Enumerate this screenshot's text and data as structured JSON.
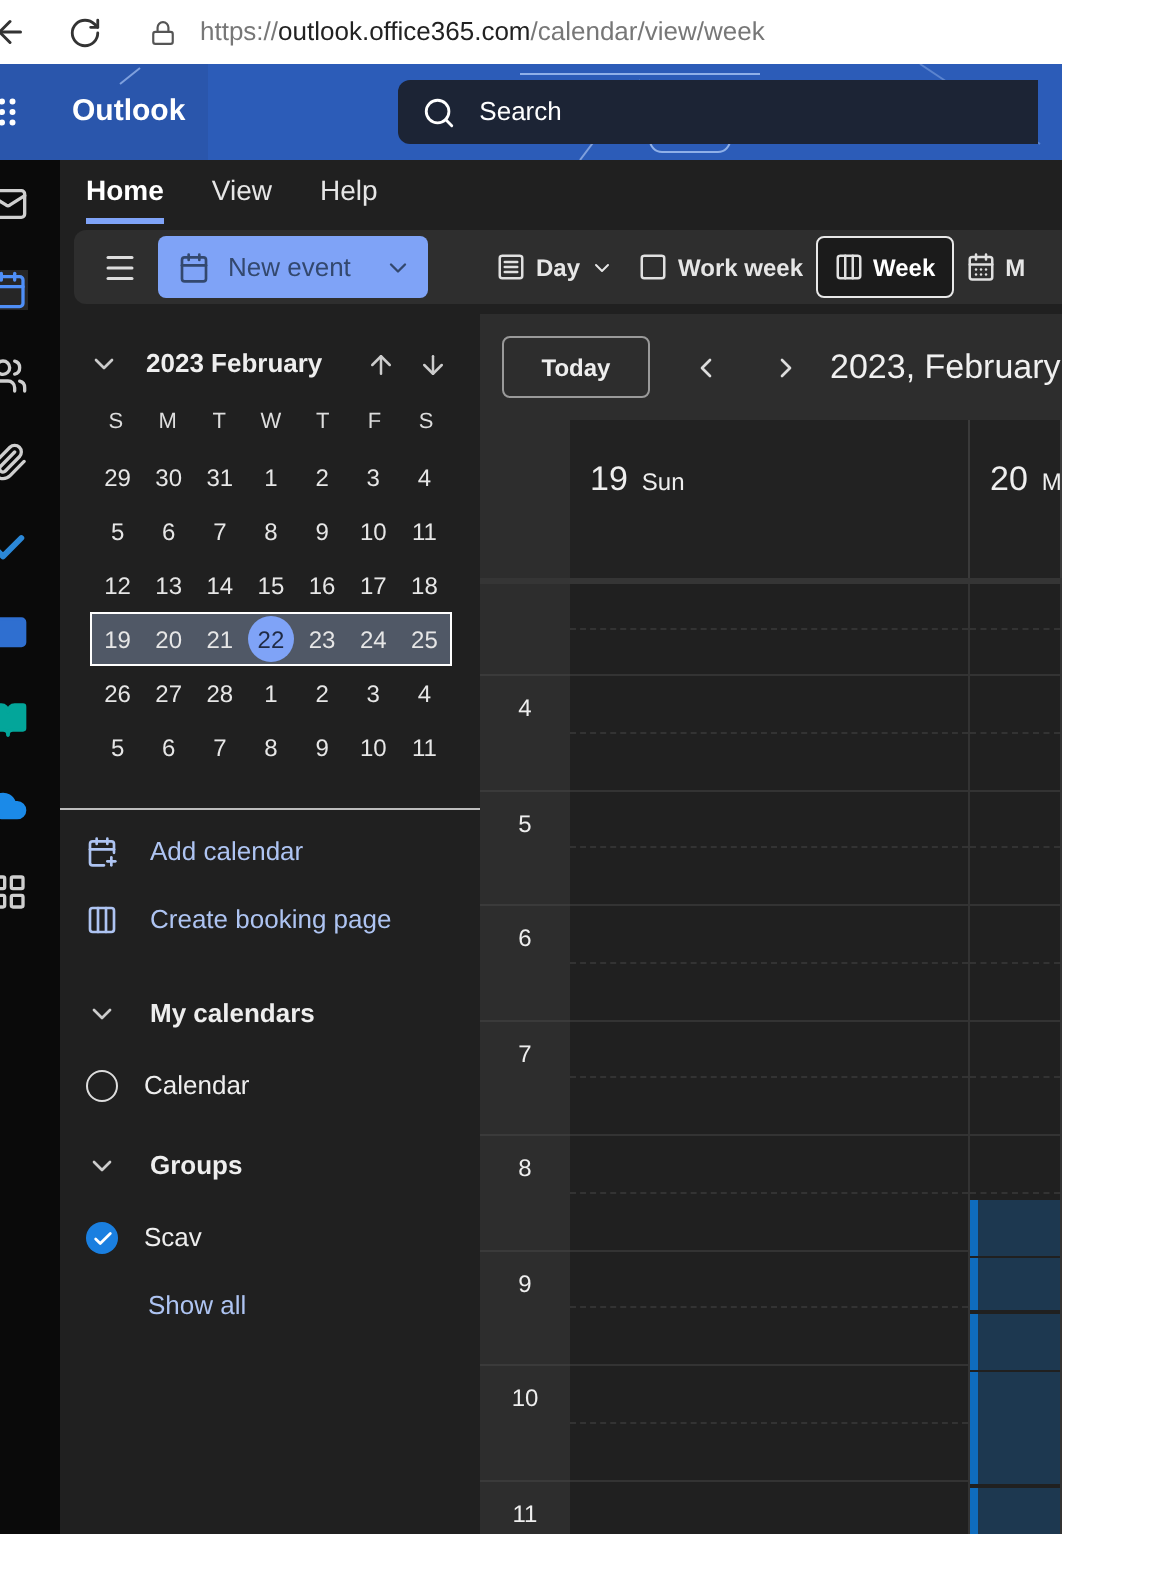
{
  "browser": {
    "url_scheme": "https://",
    "url_host": "outlook.office365.com",
    "url_path": "/calendar/view/week"
  },
  "header": {
    "app_name": "Outlook",
    "search_placeholder": "Search"
  },
  "rail": [
    {
      "kind": "mail",
      "selected": false
    },
    {
      "kind": "calendar",
      "selected": true
    },
    {
      "kind": "people",
      "selected": false
    },
    {
      "kind": "attach",
      "selected": false
    },
    {
      "kind": "todo",
      "selected": false
    },
    {
      "kind": "yammer",
      "selected": false
    },
    {
      "kind": "bookings",
      "selected": false
    },
    {
      "kind": "onedrive",
      "selected": false
    },
    {
      "kind": "apps",
      "selected": false
    }
  ],
  "ribbon_tabs": [
    {
      "label": "Home",
      "selected": true
    },
    {
      "label": "View",
      "selected": false
    },
    {
      "label": "Help",
      "selected": false
    }
  ],
  "toolbar": {
    "new_event": "New event",
    "views": [
      {
        "label": "Day",
        "kind": "day",
        "dropdown": true,
        "selected": false
      },
      {
        "label": "Work week",
        "kind": "workweek",
        "dropdown": false,
        "selected": false
      },
      {
        "label": "Week",
        "kind": "week",
        "dropdown": false,
        "selected": true
      },
      {
        "label": "M",
        "kind": "month",
        "dropdown": false,
        "selected": false
      }
    ]
  },
  "mini_calendar": {
    "title": "2023 February",
    "weekdays": [
      "S",
      "M",
      "T",
      "W",
      "T",
      "F",
      "S"
    ],
    "weeks": [
      {
        "selected": false,
        "days": [
          {
            "text": "29",
            "today": false
          },
          {
            "text": "30",
            "today": false
          },
          {
            "text": "31",
            "today": false
          },
          {
            "text": "1",
            "today": false
          },
          {
            "text": "2",
            "today": false
          },
          {
            "text": "3",
            "today": false
          },
          {
            "text": "4",
            "today": false
          }
        ]
      },
      {
        "selected": false,
        "days": [
          {
            "text": "5",
            "today": false
          },
          {
            "text": "6",
            "today": false
          },
          {
            "text": "7",
            "today": false
          },
          {
            "text": "8",
            "today": false
          },
          {
            "text": "9",
            "today": false
          },
          {
            "text": "10",
            "today": false
          },
          {
            "text": "11",
            "today": false
          }
        ]
      },
      {
        "selected": false,
        "days": [
          {
            "text": "12",
            "today": false
          },
          {
            "text": "13",
            "today": false
          },
          {
            "text": "14",
            "today": false
          },
          {
            "text": "15",
            "today": false
          },
          {
            "text": "16",
            "today": false
          },
          {
            "text": "17",
            "today": false
          },
          {
            "text": "18",
            "today": false
          }
        ]
      },
      {
        "selected": true,
        "days": [
          {
            "text": "19",
            "today": false
          },
          {
            "text": "20",
            "today": false
          },
          {
            "text": "21",
            "today": false
          },
          {
            "text": "22",
            "today": true
          },
          {
            "text": "23",
            "today": false
          },
          {
            "text": "24",
            "today": false
          },
          {
            "text": "25",
            "today": false
          }
        ]
      },
      {
        "selected": false,
        "days": [
          {
            "text": "26",
            "today": false
          },
          {
            "text": "27",
            "today": false
          },
          {
            "text": "28",
            "today": false
          },
          {
            "text": "1",
            "today": false
          },
          {
            "text": "2",
            "today": false
          },
          {
            "text": "3",
            "today": false
          },
          {
            "text": "4",
            "today": false
          }
        ]
      },
      {
        "selected": false,
        "days": [
          {
            "text": "5",
            "today": false
          },
          {
            "text": "6",
            "today": false
          },
          {
            "text": "7",
            "today": false
          },
          {
            "text": "8",
            "today": false
          },
          {
            "text": "9",
            "today": false
          },
          {
            "text": "10",
            "today": false
          },
          {
            "text": "11",
            "today": false
          }
        ]
      }
    ]
  },
  "nav_links": [
    {
      "label": "Add calendar",
      "kind": "add"
    },
    {
      "label": "Create booking page",
      "kind": "booking"
    }
  ],
  "sections": [
    {
      "title": "My calendars",
      "expanded": true,
      "calendars": [
        {
          "name": "Calendar",
          "checked": false
        }
      ]
    },
    {
      "title": "Groups",
      "expanded": true,
      "calendars": [
        {
          "name": "Scav",
          "checked": true
        }
      ]
    }
  ],
  "show_all": "Show all",
  "calendar": {
    "today_button": "Today",
    "range_title": "2023, February",
    "days": [
      {
        "number": "19",
        "name": "Sun",
        "has_events": false
      },
      {
        "number": "20",
        "name": "M",
        "has_events": true
      }
    ],
    "hours": [
      "4",
      "5",
      "6",
      "7",
      "8",
      "9",
      "10",
      "11"
    ]
  }
}
